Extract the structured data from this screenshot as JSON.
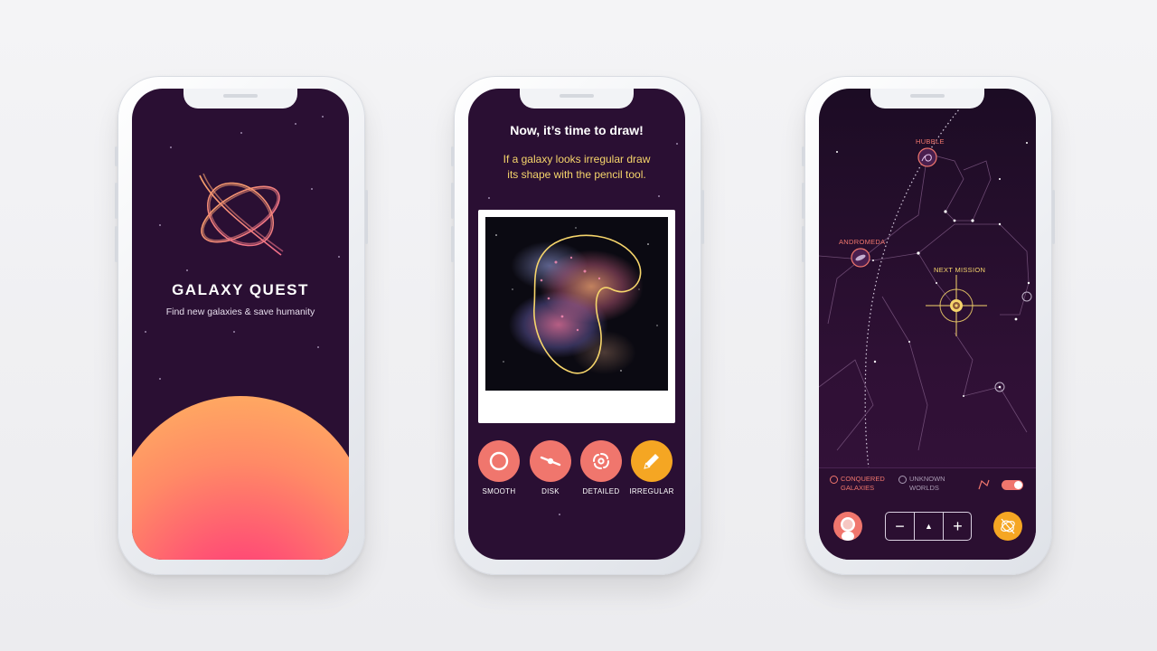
{
  "screen1": {
    "title": "GALAXY QUEST",
    "subtitle": "Find new galaxies & save humanity",
    "logo_icon": "galaxy-orbit-logo",
    "planet_colors": [
      "#ffa662",
      "#ff2d7b"
    ]
  },
  "screen2": {
    "heading": "Now, it’s time to draw!",
    "instruction_line1": "If a galaxy looks irregular draw",
    "instruction_line2": "its shape with the pencil tool.",
    "tools": [
      {
        "label": "SMOOTH",
        "icon": "circle-icon",
        "selected": false
      },
      {
        "label": "DISK",
        "icon": "disk-icon",
        "selected": false
      },
      {
        "label": "DETAILED",
        "icon": "spiral-icon",
        "selected": false
      },
      {
        "label": "IRREGULAR",
        "icon": "pencil-icon",
        "selected": true
      }
    ],
    "tool_color": "#f0766d",
    "selected_color": "#f5a623",
    "highlight_color": "#f6d56b"
  },
  "screen3": {
    "markers": {
      "hubble": "HUBBLE",
      "andromeda": "ANDROMEDA",
      "next_mission": "NEXT MISSION"
    },
    "legend": {
      "conquered_line1": "CONQUERED",
      "conquered_line2": "GALAXIES",
      "unknown_line1": "UNKNOWN",
      "unknown_line2": "WORLDS",
      "toggle_on": true
    },
    "controls": {
      "zoom_out": "−",
      "up": "▲",
      "zoom_in": "+"
    },
    "accent_color": "#f0766d",
    "mission_color": "#f6d56b"
  }
}
